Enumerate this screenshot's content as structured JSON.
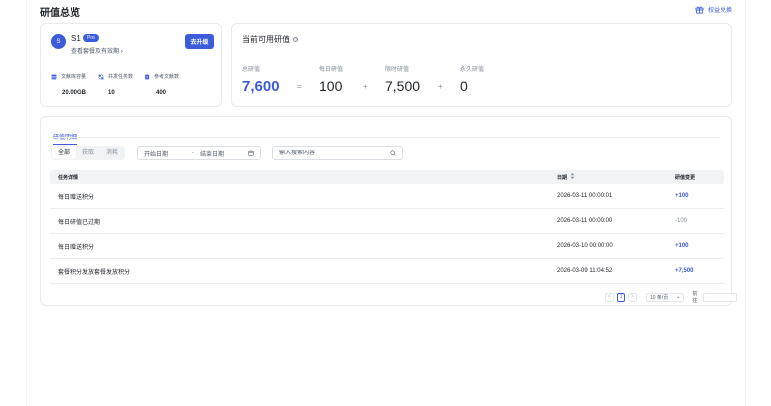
{
  "header": {
    "title": "研值总览",
    "redeem_label": "权益兑换",
    "redeem_icon": "gift-icon"
  },
  "user": {
    "avatar_letter": "S",
    "name": "S1",
    "badge": "Pro",
    "plan_link": "查看套餐及有效期",
    "upgrade_label": "去升级",
    "quotas": [
      {
        "label": "文献库容量",
        "value": "20.00GB",
        "icon": "database-icon"
      },
      {
        "label": "并发任务数",
        "value": "10",
        "icon": "tasks-icon"
      },
      {
        "label": "参考文献数",
        "value": "400",
        "icon": "document-icon"
      }
    ]
  },
  "balance": {
    "title": "当前可用研值",
    "metrics": [
      {
        "label": "总研值",
        "value": "7,600"
      },
      {
        "label": "每日研值",
        "value": "100"
      },
      {
        "label": "限时研值",
        "value": "7,500"
      },
      {
        "label": "永久研值",
        "value": "0"
      }
    ],
    "ops": [
      "=",
      "+",
      "+"
    ]
  },
  "detail": {
    "tab": "研值明细",
    "filters": [
      "全部",
      "获取",
      "消耗"
    ],
    "date_start_placeholder": "开始日期",
    "date_sep": "-",
    "date_end_placeholder": "结束日期",
    "search_placeholder": "输入搜索内容",
    "columns": [
      "任务详情",
      "日期",
      "研值变更"
    ],
    "rows": [
      {
        "task": "每日赠送积分",
        "date": "2026-03-11 00:00:01",
        "change": "+100"
      },
      {
        "task": "每日研值已过期",
        "date": "2026-03-11 00:00:00",
        "change": "-100"
      },
      {
        "task": "每日赠送积分",
        "date": "2026-03-10 00:00:00",
        "change": "+100"
      },
      {
        "task": "套餐积分发放套餐发放积分",
        "date": "2026-03-09 11:04:52",
        "change": "+7,500"
      }
    ],
    "pagination": {
      "prev": "<",
      "current": "1",
      "next": ">",
      "page_size": "10 条/页",
      "goto_label": "前往"
    }
  },
  "colors": {
    "accent": "#3b5bdb",
    "muted": "#86909c",
    "border": "#e8eaed"
  }
}
